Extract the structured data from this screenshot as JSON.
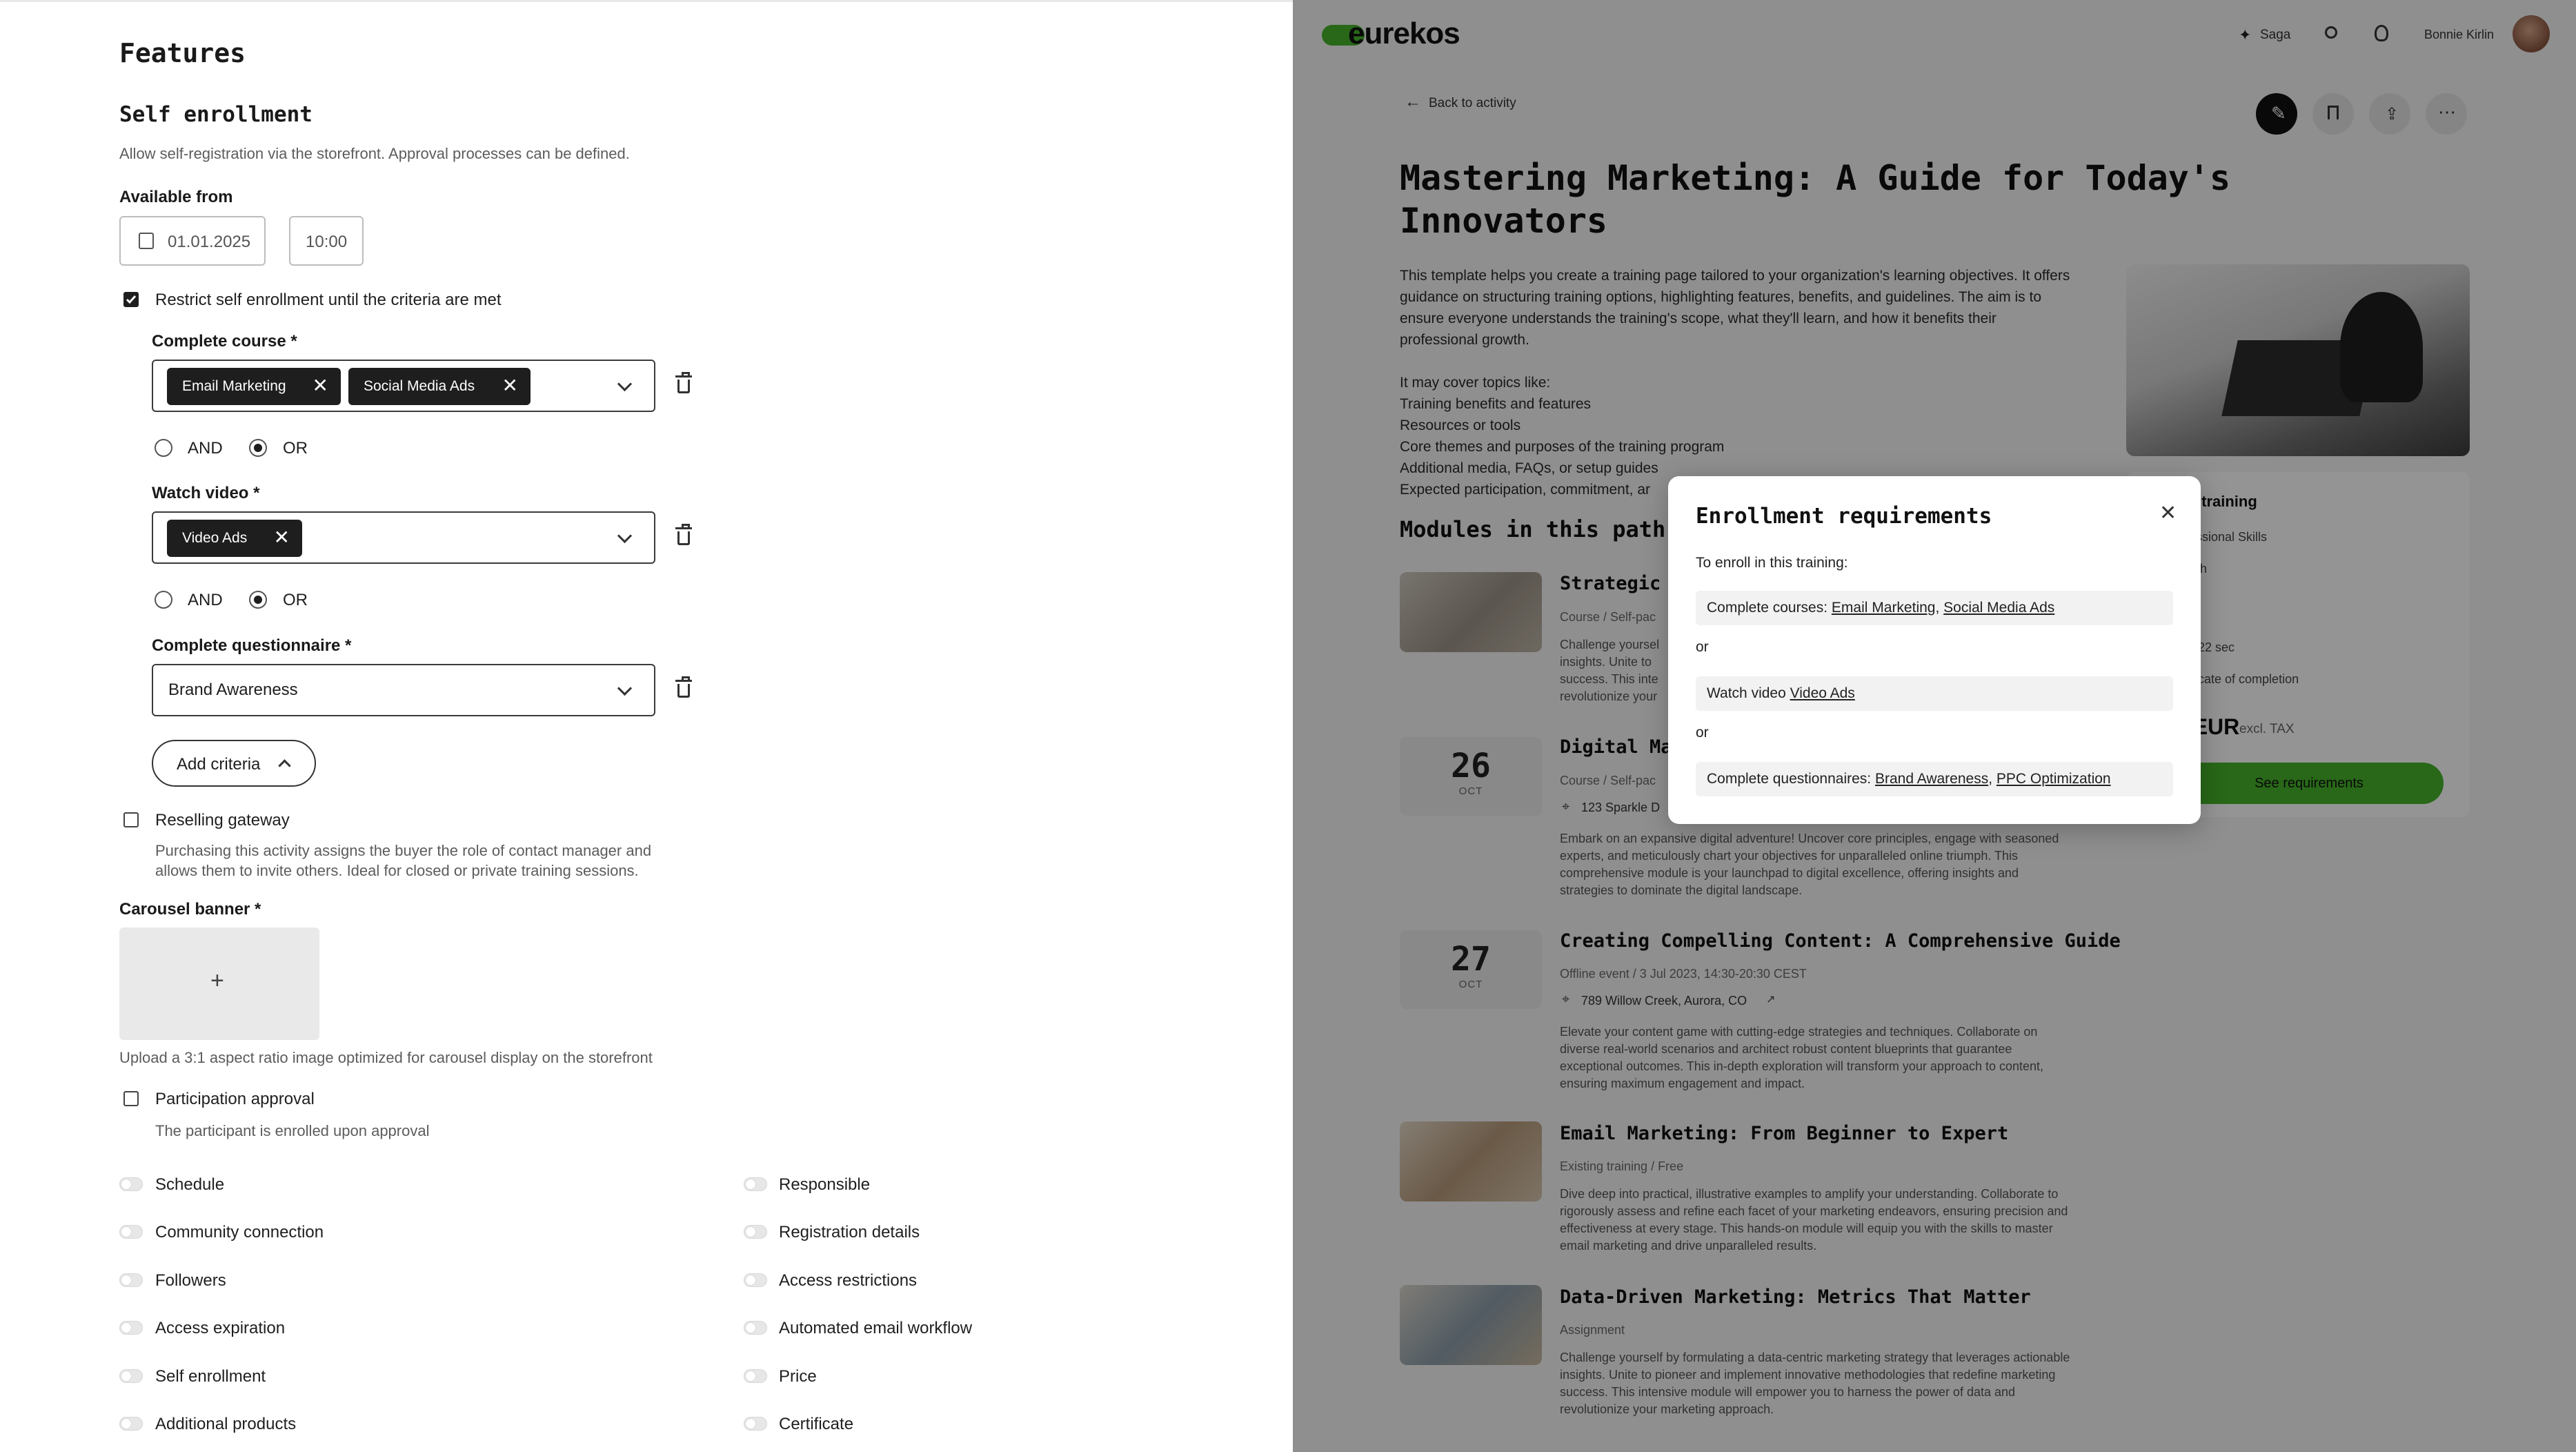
{
  "left": {
    "title": "Features",
    "self_enrollment": {
      "heading": "Self enrollment",
      "description": "Allow self-registration via the storefront. Approval processes can be defined.",
      "available_from_label": "Available from",
      "date_value": "01.01.2025",
      "time_value": "10:00",
      "restrict_label": "Restrict self enrollment until the criteria are met",
      "restrict_checked": true,
      "criteria": {
        "course_label": "Complete course *",
        "course_chips": [
          "Email Marketing",
          "Social Media Ads"
        ],
        "video_label": "Watch video *",
        "video_chips": [
          "Video Ads"
        ],
        "questionnaire_label": "Complete questionnaire *",
        "questionnaire_value": "Brand Awareness",
        "and_label": "AND",
        "or_label": "OR",
        "selected_operator": "OR",
        "add_criteria_label": "Add criteria"
      }
    },
    "reselling": {
      "label": "Reselling gateway",
      "description_line1": "Purchasing this activity assigns the buyer the role of contact manager and",
      "description_line2": "allows them to invite others. Ideal for closed or private training sessions."
    },
    "carousel": {
      "label": "Carousel banner *",
      "plus": "+",
      "hint": "Upload a 3:1 aspect ratio image optimized for carousel display on the storefront"
    },
    "participation": {
      "label": "Participation approval",
      "description": "The participant is enrolled upon approval"
    },
    "toggles_left": [
      "Schedule",
      "Community connection",
      "Followers",
      "Access expiration",
      "Self enrollment",
      "Additional products"
    ],
    "toggles_right": [
      "Responsible",
      "Registration details",
      "Access restrictions",
      "Automated email workflow",
      "Price",
      "Certificate"
    ]
  },
  "right": {
    "logo": "eurekos",
    "saga_label": "Saga",
    "user_name": "Bonnie Kirlin",
    "back_label": "Back to activity",
    "title_line1": "Mastering Marketing: A Guide for Today's",
    "title_line2": "Innovators",
    "intro_lines": [
      "This template helps you create a training page tailored to your organization's learning objectives. It offers",
      "guidance on structuring training options, highlighting features, benefits, and guidelines. The aim is to",
      "ensure everyone understands the training's scope, what they'll learn, and how it benefits their",
      "professional growth."
    ],
    "topics_heading": "It may cover topics like:",
    "topics": [
      "Training benefits and features",
      "Resources or tools",
      "Core themes and purposes of the training program",
      "Additional media, FAQs, or setup guides",
      "Expected participation, commitment, ar"
    ],
    "modules_heading": "Modules in this path",
    "side_card": {
      "heading": "the training",
      "skills": "rofessional Skills",
      "language": "nglish",
      "section": "es",
      "duration": "min 22 sec",
      "certificate": "ertificate of completion",
      "price": "5 EUR",
      "tax": "excl. TAX",
      "button": "See requirements",
      "accent": "#45b32a"
    },
    "modules": [
      {
        "title": "Strategic",
        "meta": "Course / Self-pac",
        "desc": [
          "Challenge yoursel",
          "insights. Unite to",
          "success. This inte",
          "revolutionize your"
        ]
      },
      {
        "day": "26",
        "month": "OCT",
        "title": "Digital Ma",
        "meta": "Course / Self-pac",
        "location": "123 Sparkle D",
        "desc": [
          "Embark on an expansive digital adventure! Uncover core principles, engage with seasoned",
          "experts, and meticulously chart your objectives for unparalleled online triumph. This",
          "comprehensive module is your launchpad to digital excellence, offering insights and",
          "strategies to dominate the digital landscape."
        ]
      },
      {
        "day": "27",
        "month": "OCT",
        "title": "Creating Compelling Content: A Comprehensive Guide",
        "meta": "Offline event / 3 Jul 2023, 14:30-20:30 CEST",
        "location": "789 Willow Creek, Aurora, CO",
        "desc": [
          "Elevate your content game with cutting-edge strategies and techniques. Collaborate on",
          "diverse real-world scenarios and architect robust content blueprints that guarantee",
          "exceptional outcomes. This in-depth exploration will transform your approach to content,",
          "ensuring maximum engagement and impact."
        ]
      },
      {
        "title": "Email Marketing: From Beginner to Expert",
        "meta": "Existing training / Free",
        "desc": [
          "Dive deep into practical, illustrative examples to amplify your understanding. Collaborate to",
          "rigorously assess and refine each facet of your marketing endeavors, ensuring precision and",
          "effectiveness at every stage. This hands-on module will equip you with the skills to master",
          "email marketing and drive unparalleled results."
        ]
      },
      {
        "title": "Data-Driven Marketing: Metrics That Matter",
        "meta": "Assignment",
        "desc": [
          "Challenge yourself by formulating a data-centric marketing strategy that leverages actionable",
          "insights. Unite to pioneer and implement innovative methodologies that redefine marketing",
          "success. This intensive module will empower you to harness the power of data and",
          "revolutionize your marketing approach."
        ]
      }
    ]
  },
  "modal": {
    "title": "Enrollment requirements",
    "intro": "To enroll in this training:",
    "row1_prefix": "Complete courses: ",
    "row1_link1": "Email Marketing",
    "row1_sep": ", ",
    "row1_link2": "Social Media Ads",
    "or1": "or",
    "row2_prefix": "Watch video ",
    "row2_link1": "Video Ads",
    "or2": "or",
    "row3_prefix": "Complete questionnaires: ",
    "row3_link1": "Brand Awareness",
    "row3_sep": ", ",
    "row3_link2": "PPC Optimization"
  }
}
